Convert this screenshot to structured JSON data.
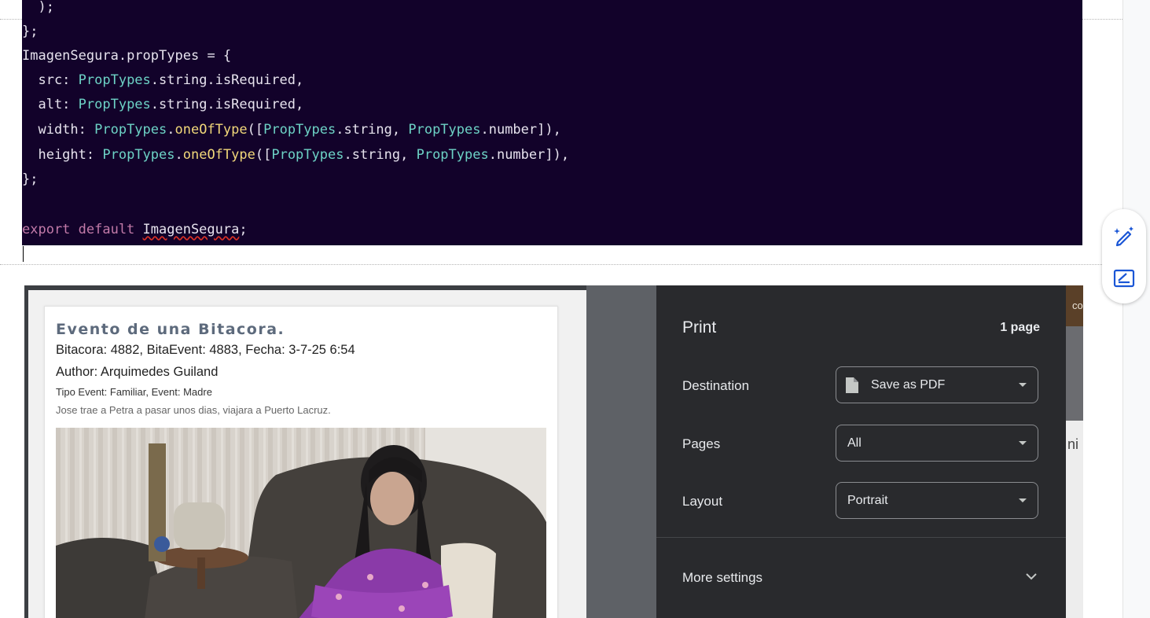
{
  "code": {
    "lines": [
      [
        {
          "t": "  );",
          "c": "tk-punct"
        }
      ],
      [
        {
          "t": "};",
          "c": "tk-punct"
        }
      ],
      [
        {
          "t": "ImagenSegura",
          "c": "tk-ident"
        },
        {
          "t": ".",
          "c": "tk-punct"
        },
        {
          "t": "propTypes",
          "c": "tk-ident"
        },
        {
          "t": " = {",
          "c": "tk-punct"
        }
      ],
      [
        {
          "t": "  src: ",
          "c": "tk-ident"
        },
        {
          "t": "PropTypes",
          "c": "tk-type"
        },
        {
          "t": ".string.isRequired,",
          "c": "tk-ident"
        }
      ],
      [
        {
          "t": "  alt: ",
          "c": "tk-ident"
        },
        {
          "t": "PropTypes",
          "c": "tk-type"
        },
        {
          "t": ".string.isRequired,",
          "c": "tk-ident"
        }
      ],
      [
        {
          "t": "  width: ",
          "c": "tk-ident"
        },
        {
          "t": "PropTypes",
          "c": "tk-type"
        },
        {
          "t": ".",
          "c": "tk-punct"
        },
        {
          "t": "oneOfType",
          "c": "tk-fn"
        },
        {
          "t": "([",
          "c": "tk-punct"
        },
        {
          "t": "PropTypes",
          "c": "tk-type"
        },
        {
          "t": ".string, ",
          "c": "tk-ident"
        },
        {
          "t": "PropTypes",
          "c": "tk-type"
        },
        {
          "t": ".number]),",
          "c": "tk-ident"
        }
      ],
      [
        {
          "t": "  height: ",
          "c": "tk-ident"
        },
        {
          "t": "PropTypes",
          "c": "tk-type"
        },
        {
          "t": ".",
          "c": "tk-punct"
        },
        {
          "t": "oneOfType",
          "c": "tk-fn"
        },
        {
          "t": "([",
          "c": "tk-punct"
        },
        {
          "t": "PropTypes",
          "c": "tk-type"
        },
        {
          "t": ".string, ",
          "c": "tk-ident"
        },
        {
          "t": "PropTypes",
          "c": "tk-type"
        },
        {
          "t": ".number]),",
          "c": "tk-ident"
        }
      ],
      [
        {
          "t": "};",
          "c": "tk-punct"
        }
      ],
      [],
      [
        {
          "t": "export default ",
          "c": "tk-kw"
        },
        {
          "t": "ImagenSegura",
          "c": "tk-ident squiggle"
        },
        {
          "t": ";",
          "c": "tk-punct"
        }
      ]
    ]
  },
  "side_tools": {
    "items": [
      "magic-pen-icon",
      "signature-icon"
    ]
  },
  "preview": {
    "title": "Evento de una Bitacora.",
    "line1": "Bitacora: 4882, BitaEvent: 4883, Fecha: 3-7-25 6:54",
    "line2": "Author: Arquimedes Guiland",
    "line3": "Tipo Event: Familiar, Event: Madre",
    "line4": "Jose trae a Petra a pasar unos dias, viajara a Puerto Lacruz."
  },
  "print": {
    "title": "Print",
    "page_count": "1 page",
    "destination_label": "Destination",
    "destination_value": "Save as PDF",
    "pages_label": "Pages",
    "pages_value": "All",
    "layout_label": "Layout",
    "layout_value": "Portrait",
    "more_settings": "More settings"
  },
  "right_strip": {
    "text_top": "co",
    "text_mid": "ni"
  },
  "colors": {
    "code_bg": "#12022a",
    "print_bg": "#292a2d",
    "type_color": "#6dd3c6",
    "fn_color": "#f2d87a",
    "keyword_color": "#c27aa8"
  }
}
